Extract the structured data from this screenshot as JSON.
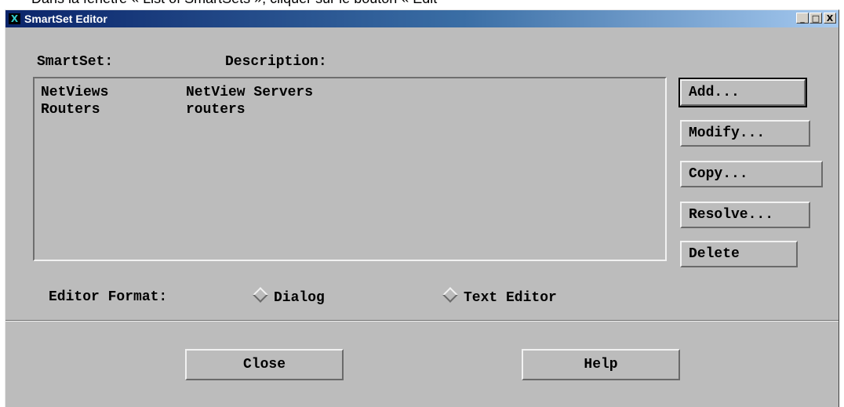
{
  "caption": "Dans la fenêtre « List of SmartSets », cliquer sur le bouton « Edit",
  "window": {
    "title": "SmartSet Editor",
    "icon": "x-app-icon",
    "controls": {
      "minimize": "_",
      "maximize": "□",
      "close": "X"
    }
  },
  "list": {
    "headers": {
      "smartset": "SmartSet:",
      "description": "Description:"
    },
    "rows": [
      {
        "name": "NetViews",
        "description": "NetView Servers"
      },
      {
        "name": "Routers",
        "description": "routers"
      }
    ]
  },
  "actions": {
    "add": "Add...",
    "modify": "Modify...",
    "copy": "Copy...",
    "resolve": "Resolve...",
    "delete": "Delete"
  },
  "editor_format": {
    "label": "Editor Format:",
    "options": [
      "Dialog",
      "Text Editor"
    ]
  },
  "footer": {
    "close": "Close",
    "help": "Help"
  }
}
